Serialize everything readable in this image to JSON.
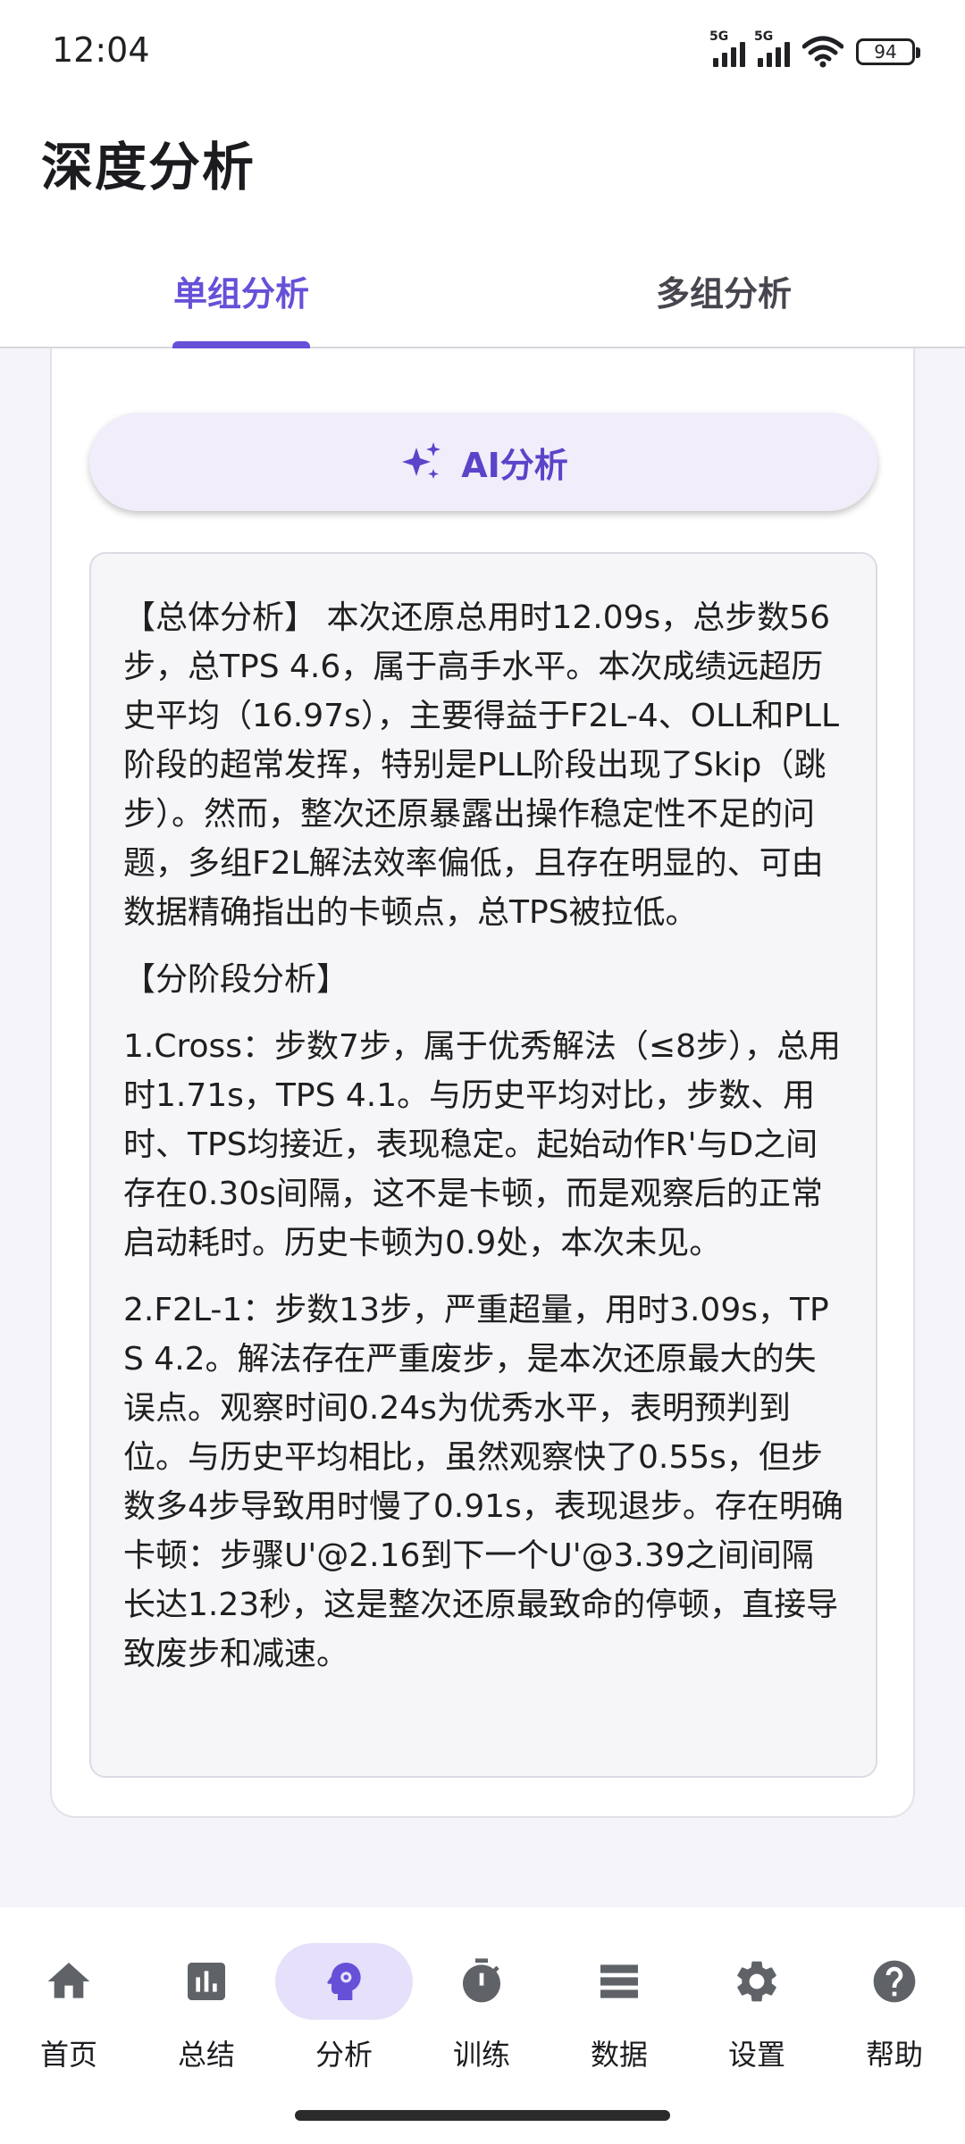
{
  "status_bar": {
    "time": "12:04",
    "network_1": "5G",
    "network_2": "5G",
    "battery": "94"
  },
  "header": {
    "title": "深度分析"
  },
  "tabs": [
    {
      "label": "单组分析",
      "active": true
    },
    {
      "label": "多组分析",
      "active": false
    }
  ],
  "ai_button": {
    "label": "AI分析",
    "icon": "sparkle-icon"
  },
  "analysis": {
    "paragraphs": [
      "【总体分析】 本次还原总用时12.09s，总步数56步，总TPS 4.6，属于高手水平。本次成绩远超历史平均（16.97s），主要得益于F2L-4、OLL和PLL阶段的超常发挥，特别是PLL阶段出现了Skip（跳步）。然而，整次还原暴露出操作稳定性不足的问题，多组F2L解法效率偏低，且存在明显的、可由数据精确指出的卡顿点，总TPS被拉低。",
      "【分阶段分析】",
      "1.Cross：步数7步，属于优秀解法（≤8步），总用时1.71s，TPS 4.1。与历史平均对比，步数、用时、TPS均接近，表现稳定。起始动作R'与D之间存在0.30s间隔，这不是卡顿，而是观察后的正常启动耗时。历史卡顿为0.9处，本次未见。",
      "2.F2L-1：步数13步，严重超量，用时3.09s，TPS 4.2。解法存在严重废步，是本次还原最大的失误点。观察时间0.24s为优秀水平，表明预判到位。与历史平均相比，虽然观察快了0.55s，但步数多4步导致用时慢了0.91s，表现退步。存在明确卡顿：步骤U'@2.16到下一个U'@3.39之间间隔长达1.23秒，这是整次还原最致命的停顿，直接导致废步和减速。"
    ]
  },
  "bottom_nav": [
    {
      "label": "首页",
      "icon": "home-icon",
      "active": false
    },
    {
      "label": "总结",
      "icon": "chart-icon",
      "active": false
    },
    {
      "label": "分析",
      "icon": "brain-icon",
      "active": true
    },
    {
      "label": "训练",
      "icon": "timer-icon",
      "active": false
    },
    {
      "label": "数据",
      "icon": "list-icon",
      "active": false
    },
    {
      "label": "设置",
      "icon": "gear-icon",
      "active": false
    },
    {
      "label": "帮助",
      "icon": "help-icon",
      "active": false
    }
  ],
  "colors": {
    "accent": "#6750d8",
    "icon_gray": "#5f6368",
    "background": "#f4f4f9"
  }
}
